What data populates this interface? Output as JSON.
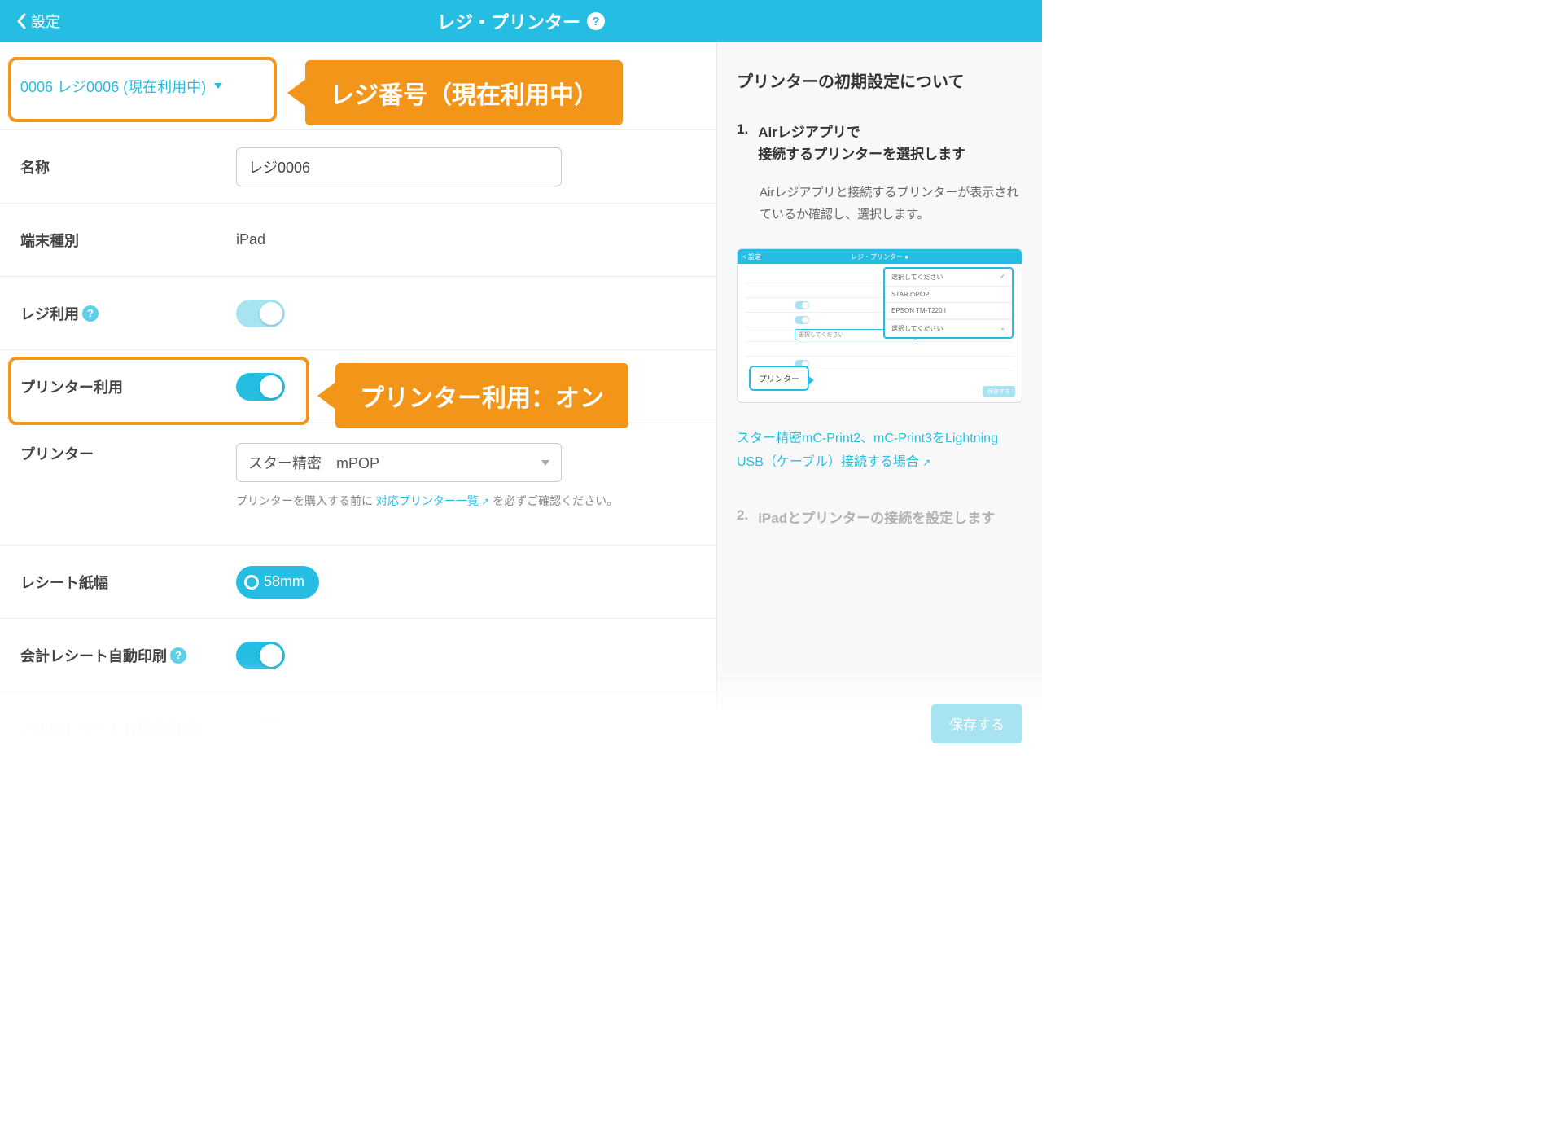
{
  "header": {
    "back_label": "設定",
    "title": "レジ・プリンター"
  },
  "selector": {
    "text": "0006  レジ0006 (現在利用中)"
  },
  "rows": {
    "name_label": "名称",
    "name_value": "レジ0006",
    "device_label": "端末種別",
    "device_value": "iPad",
    "reg_use_label": "レジ利用",
    "printer_use_label": "プリンター利用",
    "printer_label": "プリンター",
    "printer_value": "スター精密　mPOP",
    "printer_hint_pre": "プリンターを購入する前に ",
    "printer_hint_link": "対応プリンター一覧",
    "printer_hint_post": " を必ずご確認ください。",
    "paper_label": "レシート紙幅",
    "paper_value": "58mm",
    "autoprint_label": "会計レシート自動印刷",
    "cash_label": "入出金レシート自動印刷"
  },
  "callouts": {
    "c1": "レジ番号（現在利用中）",
    "c2": "プリンター利用：オン"
  },
  "side": {
    "title": "プリンターの初期設定について",
    "step1_num": "1.",
    "step1_head": "Airレジアプリで\n接続するプリンターを選択します",
    "step1_desc": "Airレジアプリと接続するプリンターが表示されているか確認し、選択します。",
    "mini": {
      "back": "< 設定",
      "title": "レジ・プリンター ●",
      "opt_placeholder": "選択してください",
      "opt1": "STAR mPOP",
      "opt2": "EPSON TM-T220II",
      "sel_placeholder": "選択してください",
      "box_label": "プリンター",
      "save": "保存する"
    },
    "link1": "スター精密mC-Print2、mC-Print3をLightning USB（ケーブル）接続する場合",
    "step2_num": "2.",
    "step2_head": "iPadとプリンターの接続を設定します"
  },
  "footer": {
    "save": "保存する"
  }
}
